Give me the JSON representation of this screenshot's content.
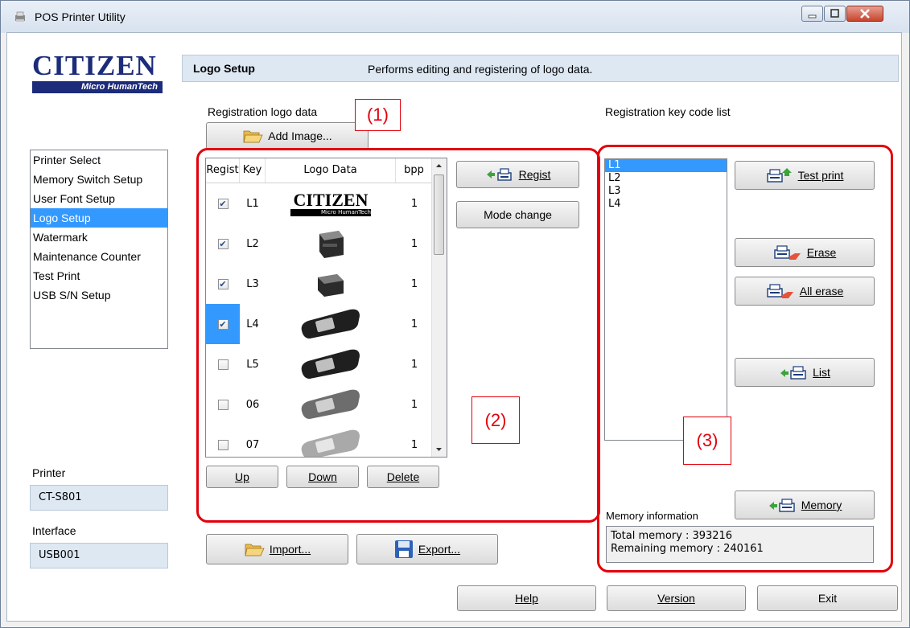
{
  "window": {
    "title": "POS Printer Utility"
  },
  "brand": {
    "name": "CITIZEN",
    "tagline": "Micro HumanTech"
  },
  "header": {
    "section_title": "Logo Setup",
    "description": "Performs editing and registering of logo data."
  },
  "sidebar": {
    "items": [
      {
        "label": "Printer Select",
        "selected": false
      },
      {
        "label": "Memory Switch Setup",
        "selected": false
      },
      {
        "label": "User Font Setup",
        "selected": false
      },
      {
        "label": "Logo Setup",
        "selected": true
      },
      {
        "label": "Watermark",
        "selected": false
      },
      {
        "label": "Maintenance Counter",
        "selected": false
      },
      {
        "label": "Test Print",
        "selected": false
      },
      {
        "label": "USB S/N Setup",
        "selected": false
      }
    ],
    "printer_label": "Printer",
    "printer_value": "CT-S801",
    "interface_label": "Interface",
    "interface_value": "USB001"
  },
  "logo_data": {
    "label": "Registration logo data",
    "add_image_button": "Add Image...",
    "columns": [
      "Regist",
      "Key",
      "Logo Data",
      "bpp"
    ],
    "rows": [
      {
        "regist": true,
        "key": "L1",
        "image": "citizen-logo",
        "bpp": "1"
      },
      {
        "regist": true,
        "key": "L2",
        "image": "printer-front",
        "bpp": "1"
      },
      {
        "regist": true,
        "key": "L3",
        "image": "printer-side",
        "bpp": "1"
      },
      {
        "regist": true,
        "key": "L4",
        "image": "pedometer-black",
        "bpp": "1"
      },
      {
        "regist": false,
        "key": "L5",
        "image": "pedometer-black",
        "bpp": "1"
      },
      {
        "regist": false,
        "key": "06",
        "image": "pedometer-grey",
        "bpp": "1"
      },
      {
        "regist": false,
        "key": "07",
        "image": "pedometer-light",
        "bpp": "1"
      }
    ],
    "up_button": "Up",
    "down_button": "Down",
    "delete_button": "Delete",
    "regist_button": "Regist",
    "mode_change_button": "Mode change",
    "import_button": "Import...",
    "export_button": "Export..."
  },
  "key_code": {
    "label": "Registration key code list",
    "items": [
      "L1",
      "L2",
      "L3",
      "L4"
    ],
    "test_print_button": "Test print",
    "erase_button": "Erase",
    "all_erase_button": "All erase",
    "list_button": "List",
    "memory_button": "Memory",
    "memory_info_label": "Memory information",
    "total_memory": "Total memory : 393216",
    "remaining_memory": "Remaining memory : 240161"
  },
  "annotations": [
    "(1)",
    "(2)",
    "(3)"
  ],
  "footer": {
    "help_button": "Help",
    "version_button": "Version",
    "exit_button": "Exit"
  },
  "colors": {
    "accent": "#3399ff",
    "annotation": "#e3000b",
    "brand": "#1c2c7a",
    "header_bg": "#dde8f3"
  }
}
